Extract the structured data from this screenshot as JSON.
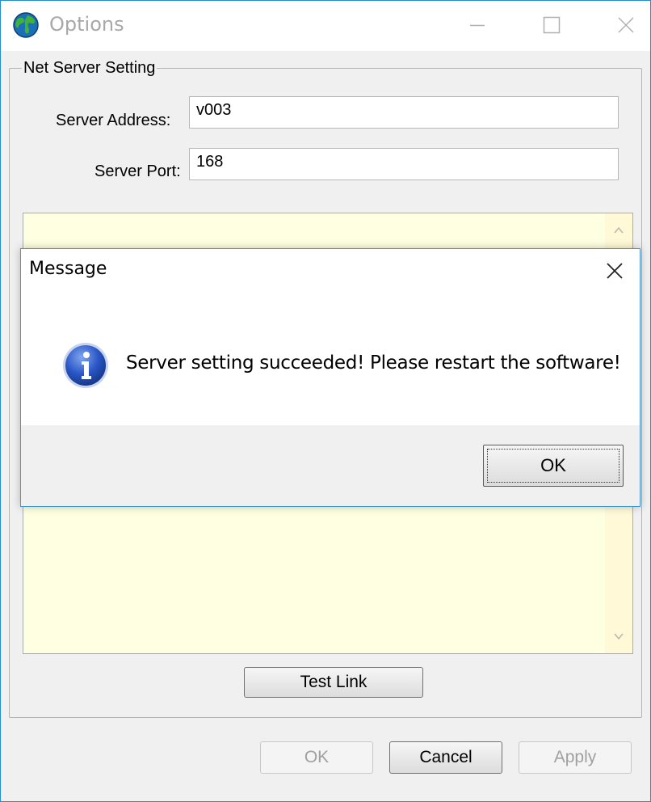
{
  "window": {
    "title": "Options",
    "app_icon": "globe-icon"
  },
  "group": {
    "label": "Net Server Setting",
    "server_address_label": "Server Address:",
    "server_address_value": "v003",
    "server_port_label": "Server Port:",
    "server_port_value": "168"
  },
  "buttons": {
    "test_link": "Test Link",
    "ok": "OK",
    "cancel": "Cancel",
    "apply": "Apply"
  },
  "dialog": {
    "title": "Message",
    "icon": "info-icon",
    "message": "Server setting succeeded! Please restart the software!",
    "ok": "OK"
  },
  "colors": {
    "window_border": "#1e8fd6",
    "textarea_bg": "#ffffe1",
    "info_blue": "#2a56c6"
  }
}
